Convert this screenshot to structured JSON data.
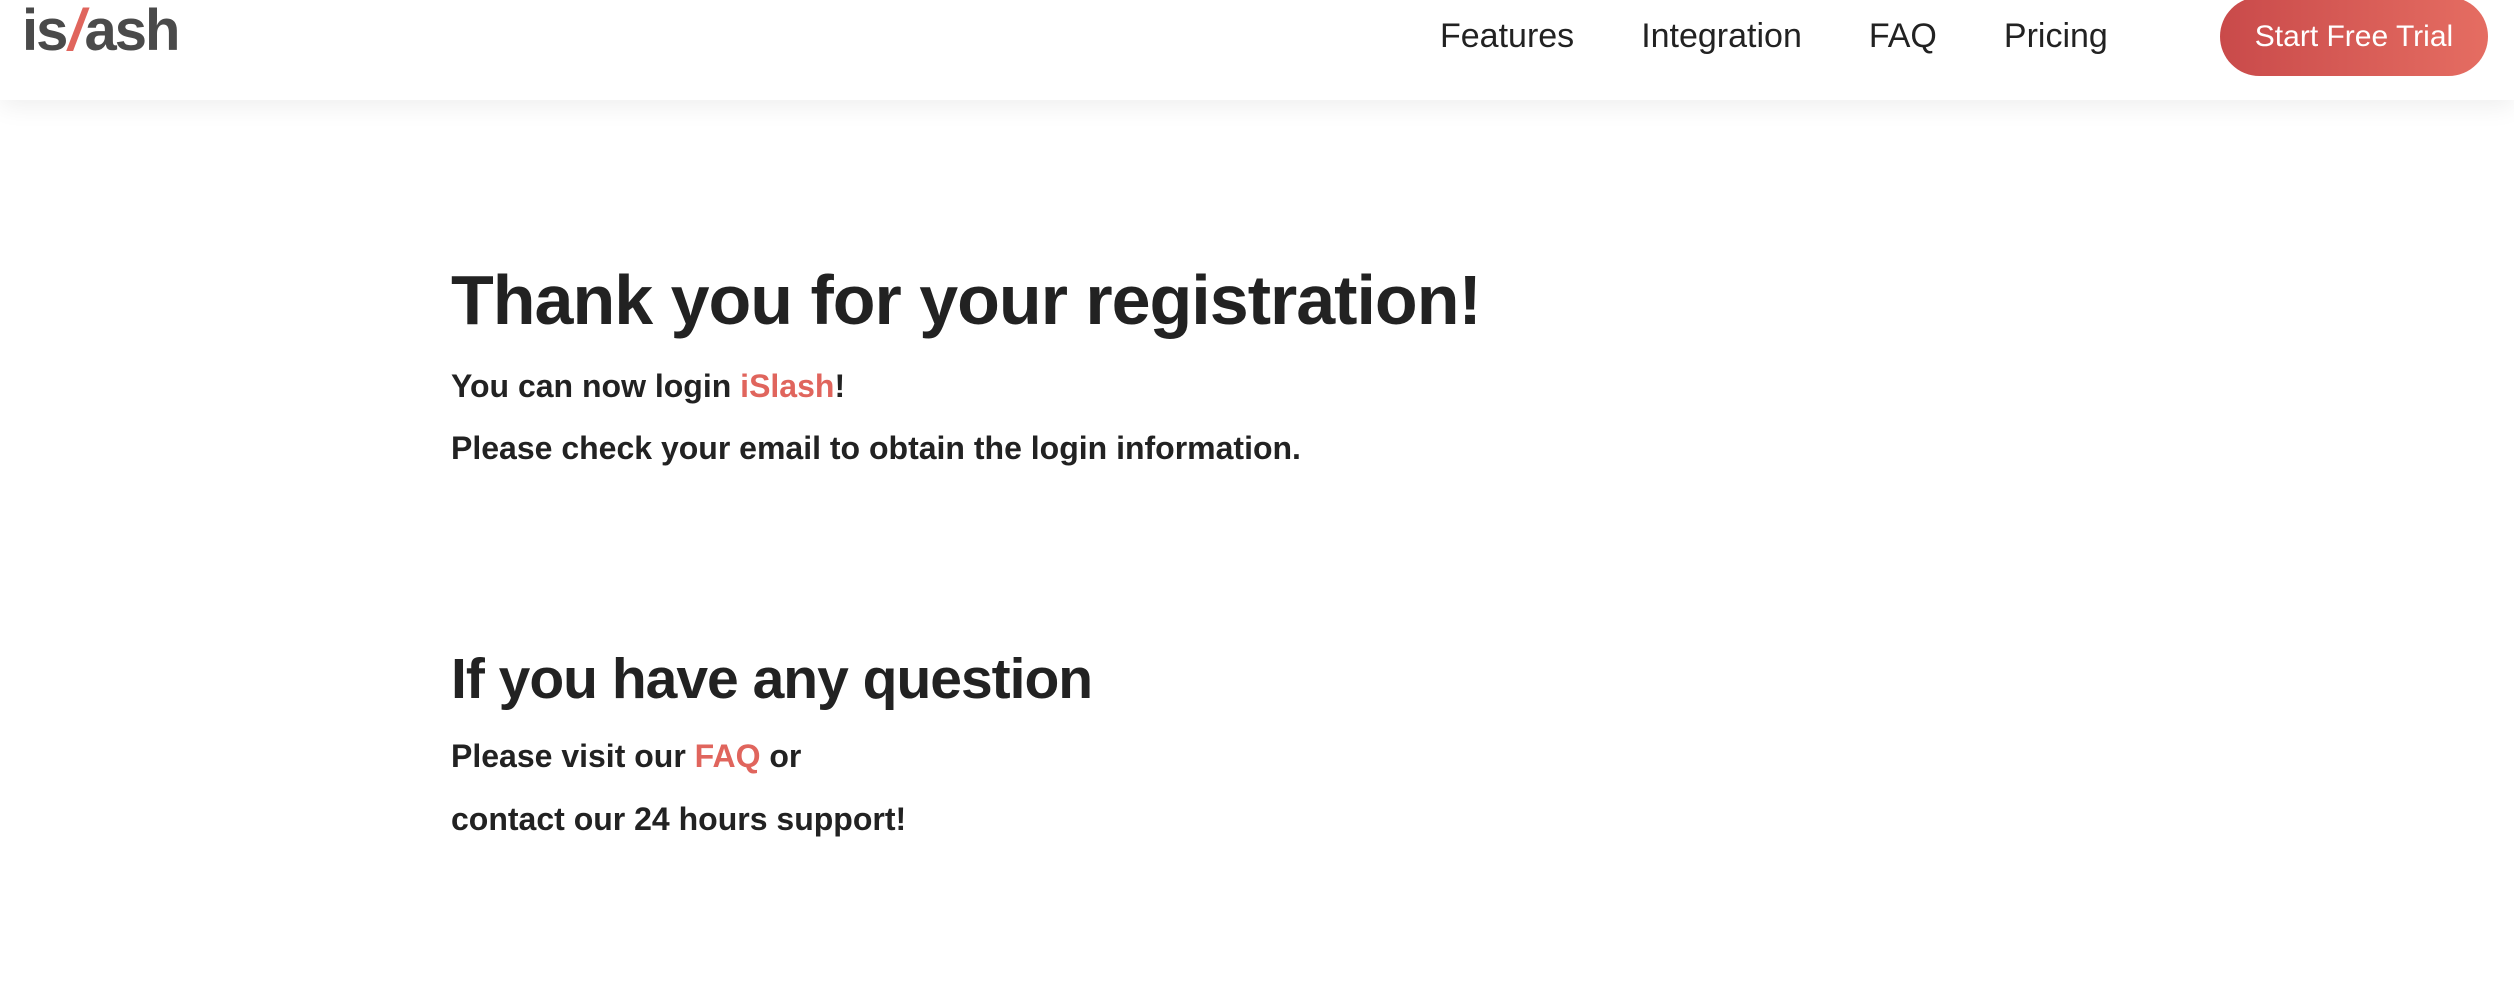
{
  "header": {
    "logo": {
      "part1": "is",
      "slash": "/",
      "part2": "ash"
    },
    "nav": [
      "Features",
      "Integration",
      "FAQ",
      "Pricing"
    ],
    "cta_label": "Start Free Trial"
  },
  "main": {
    "title": "Thank you for your registration!",
    "login_prefix": "You can now login ",
    "login_link": "iSlash",
    "login_suffix": "!",
    "email_note": "Please check your email to obtain the login information.",
    "question_heading": "If you have any question",
    "visit_prefix": "Please visit our ",
    "faq_link": "FAQ",
    "visit_suffix": " or",
    "support_note": "contact our 24 hours support!"
  },
  "colors": {
    "accent": "#e0655d",
    "text": "#222222",
    "cta_gradient_start": "#c94a4a",
    "cta_gradient_end": "#e56d62"
  }
}
